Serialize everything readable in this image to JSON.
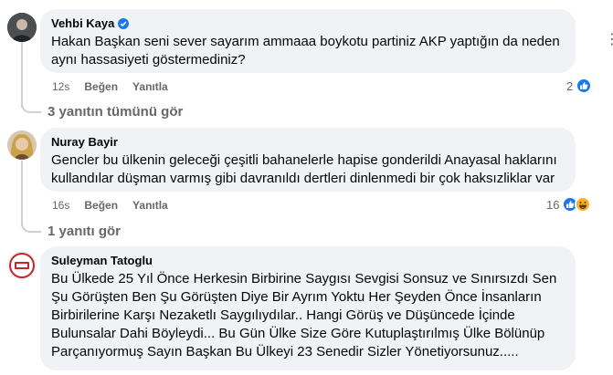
{
  "comments": [
    {
      "author": "Vehbi Kaya",
      "verified": true,
      "text": "Hakan Başkan seni sever sayarım ammaaa boykotu partiniz AKP yaptığın da neden aynı hassasiyeti göstermediniz?",
      "time": "12s",
      "like_label": "Beğen",
      "reply_label": "Yanıtla",
      "reaction_count": "2",
      "reactions": [
        "like-icon"
      ],
      "view_replies": "3 yanıtın tümünü gör"
    },
    {
      "author": "Nuray Bayir",
      "verified": false,
      "text": "Gencler bu ülkenin geleceği çeşitli bahanelerle hapise gonderildi Anayasal haklarını kullandılar düşman varmış gibi davranıldı dertleri dinlenmedi bir çok haksızliklar var",
      "time": "16s",
      "like_label": "Beğen",
      "reply_label": "Yanıtla",
      "reaction_count": "16",
      "reactions": [
        "like-icon",
        "haha-icon"
      ],
      "view_replies": "1 yanıtı gör"
    },
    {
      "author": "Suleyman Tatoglu",
      "verified": false,
      "text": "Bu Ülkede 25 Yıl Önce Herkesin Birbirine Saygısı Sevgisi Sonsuz ve Sınırsızdı Sen Şu Görüşten Ben Şu Görüşten Diye Bir Ayrım Yoktu Her Şeyden Önce İnsanların Birbirilerine Karşı Nezaketlı Saygılıydılar.. Hangi Görüş ve Düşüncede İçinde Bulunsalar Dahi Böyleydi... Bu Gün Ülke Size Göre Kutuplaştırılmış Ülke Bölünüp Parçanıyormuş Sayın Başkan Bu Ülkeyi 23 Senedir Sizler Yönetiyorsunuz....."
    }
  ],
  "colors": {
    "bubble_bg": "#f0f2f5",
    "meta_text": "#65676b",
    "like_blue": "#1877f2",
    "haha_yellow": "#f7b125",
    "thread_line": "#ced0d4"
  }
}
